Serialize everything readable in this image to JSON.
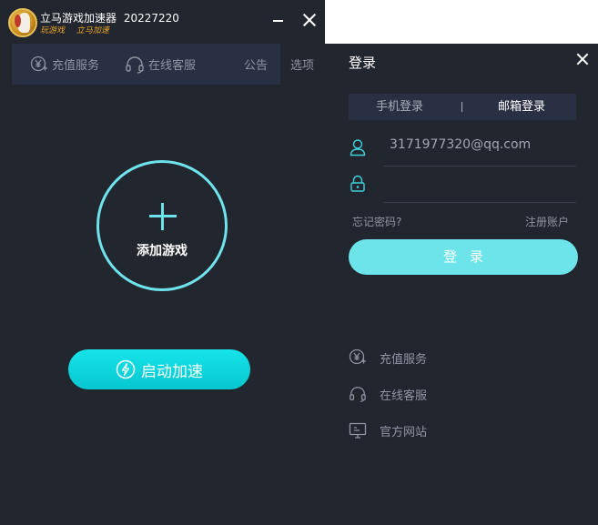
{
  "app": {
    "title": "立马游戏加速器",
    "version": "20227220",
    "slogan": [
      "玩游戏",
      "立马加速"
    ]
  },
  "toolbar": {
    "recharge": "充值服务",
    "support": "在线客服",
    "notice": "公告",
    "options": "选项"
  },
  "main": {
    "add_game": "添加游戏",
    "start_boost": "启动加速"
  },
  "login": {
    "title": "登录",
    "tabs": [
      {
        "label": "手机登录",
        "active": false
      },
      {
        "label": "邮箱登录",
        "active": true
      }
    ],
    "account_value": "3171977320@qq.com",
    "password_value": "",
    "forgot": "忘记密码?",
    "register": "注册账户",
    "submit": "登录",
    "links": [
      "充值服务",
      "在线客服",
      "官方网站"
    ]
  },
  "colors": {
    "background": "#22262e",
    "accent": "#6fe3ec",
    "toolbar_bg": "#2a3044",
    "start_button": "#07c7cf"
  }
}
